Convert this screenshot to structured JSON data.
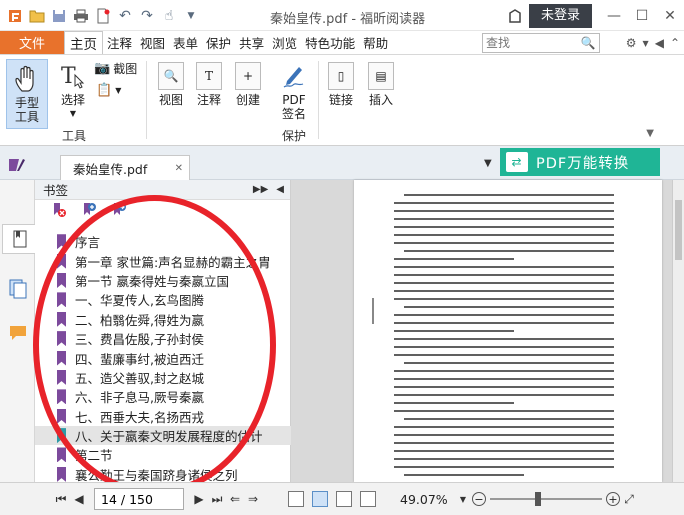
{
  "window": {
    "title": "秦始皇传.pdf - 福昕阅读器",
    "login_label": "未登录"
  },
  "menubar": {
    "file_label": "文件",
    "items": [
      "主页",
      "注释",
      "视图",
      "表单",
      "保护",
      "共享",
      "浏览",
      "特色功能",
      "帮助"
    ],
    "active_index": 0,
    "search_placeholder": "查找"
  },
  "ribbon": {
    "hand_tool": "手型\n工具",
    "select_tool": "选择",
    "screenshot": "截图",
    "tools_group": "工具",
    "view": "视图",
    "comment": "注释",
    "create": "创建",
    "pdf_sign": "PDF\n签名",
    "protect_group": "保护",
    "link": "链接",
    "insert": "插入"
  },
  "tabs": {
    "doc_tab": "秦始皇传.pdf",
    "banner": "PDF万能转换"
  },
  "bookmarks": {
    "title": "书签",
    "items": [
      "序言",
      "第一章 家世篇:声名显赫的霸主之胄",
      "第一节 嬴秦得姓与秦嬴立国",
      "一、华夏传人,玄鸟图腾",
      "二、柏翳佐舜,得姓为嬴",
      "三、费昌佐殷,子孙封侯",
      "四、蜚廉事纣,被迫西迁",
      "五、造父善驭,封之赵城",
      "六、非子息马,厥号秦嬴",
      "七、西垂大夫,名扬西戎",
      "八、关于嬴秦文明发展程度的估计",
      "第二节",
      "襄公勤王与秦国跻身诸侯之列"
    ],
    "selected_index": 10
  },
  "status": {
    "page_value": "14 / 150",
    "zoom": "49.07%",
    "zoom_fraction": 0.42
  },
  "colors": {
    "file_tab": "#e8722c",
    "banner": "#1fb596",
    "bookmark_flag": "#7c4a9c",
    "highlight": "#e8232a"
  }
}
